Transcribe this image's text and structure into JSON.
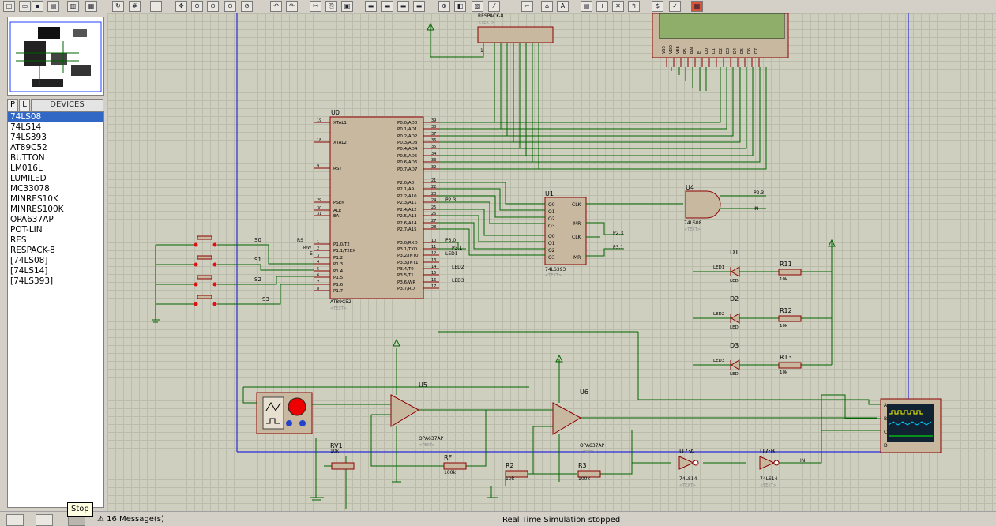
{
  "devices": {
    "header": "DEVICES",
    "tab_p": "P",
    "tab_l": "L",
    "items": [
      "74LS08",
      "74LS14",
      "74LS393",
      "AT89C52",
      "BUTTON",
      "LM016L",
      "LUMILED",
      "MC33078",
      "MINRES10K",
      "MINRES100K",
      "OPA637AP",
      "POT-LIN",
      "RES",
      "RESPACK-8",
      "[74LS08]",
      "[74LS14]",
      "[74LS393]"
    ],
    "selected": 0
  },
  "status": {
    "tooltip": "Stop",
    "messages": "16 Message(s)",
    "sim": "Real Time Simulation stopped"
  },
  "colors": {
    "wire": "#006400",
    "part": "#c8b8a0",
    "part_border": "#8b0000",
    "text": "#000080",
    "accent": "#3168c6"
  },
  "schematic": {
    "u0": {
      "ref": "U0",
      "type": "AT89C52",
      "text": "<TEXT>",
      "left_pins": [
        [
          "19",
          "XTAL1"
        ],
        [
          "18",
          "XTAL2"
        ],
        [
          "9",
          "RST"
        ],
        [
          "29",
          "PSEN"
        ],
        [
          "30",
          "ALE"
        ],
        [
          "31",
          "EA"
        ],
        [
          "1",
          "P1.0/T2"
        ],
        [
          "2",
          "P1.1/T2EX"
        ],
        [
          "3",
          "P1.2"
        ],
        [
          "4",
          "P1.3"
        ],
        [
          "5",
          "P1.4"
        ],
        [
          "6",
          "P1.5"
        ],
        [
          "7",
          "P1.6"
        ],
        [
          "8",
          "P1.7"
        ]
      ],
      "right_pins": [
        [
          "39",
          "P0.0/AD0"
        ],
        [
          "38",
          "P0.1/AD1"
        ],
        [
          "37",
          "P0.2/AD2"
        ],
        [
          "36",
          "P0.3/AD3"
        ],
        [
          "35",
          "P0.4/AD4"
        ],
        [
          "34",
          "P0.5/AD5"
        ],
        [
          "33",
          "P0.6/AD6"
        ],
        [
          "32",
          "P0.7/AD7"
        ],
        [
          "21",
          "P2.0/A8"
        ],
        [
          "22",
          "P2.1/A9"
        ],
        [
          "23",
          "P2.2/A10"
        ],
        [
          "24",
          "P2.3/A11"
        ],
        [
          "25",
          "P2.4/A12"
        ],
        [
          "26",
          "P2.5/A13"
        ],
        [
          "27",
          "P2.6/A14"
        ],
        [
          "28",
          "P2.7/A15"
        ],
        [
          "10",
          "P3.0/RXD"
        ],
        [
          "11",
          "P3.1/TXD"
        ],
        [
          "12",
          "P3.2/INT0"
        ],
        [
          "13",
          "P3.3/INT1"
        ],
        [
          "14",
          "P3.4/T0"
        ],
        [
          "15",
          "P3.5/T1"
        ],
        [
          "16",
          "P3.6/WR"
        ],
        [
          "17",
          "P3.7/RD"
        ]
      ]
    },
    "u1": {
      "ref": "U1",
      "type": "74LS393",
      "text": "<TEXT>",
      "pins": [
        "Q0",
        "Q1",
        "Q2",
        "Q3",
        "CLK",
        "MR",
        "Q0",
        "Q1",
        "Q2",
        "Q3",
        "CLK",
        "MR"
      ]
    },
    "u4": {
      "ref": "U4",
      "type": "74LS08",
      "text": "<TEXT>"
    },
    "u5": {
      "ref": "U5",
      "type": "OPA637AP",
      "text": "<TEXT>"
    },
    "u6": {
      "ref": "U6",
      "type": "OPA637AP",
      "text": "<TEXT>"
    },
    "u7a": {
      "ref": "U7:A",
      "type": "74LS14",
      "text": "<TEXT>"
    },
    "u7b": {
      "ref": "U7:B",
      "type": "74LS14",
      "text": "<TEXT>"
    },
    "lcd_pins": [
      "VSS",
      "VDD",
      "VEE",
      "RS",
      "RW",
      "E",
      "D0",
      "D1",
      "D2",
      "D3",
      "D4",
      "D5",
      "D6",
      "D7"
    ],
    "respack": {
      "ref": "RESPACK-8",
      "text": "<TEXT>"
    },
    "buttons": [
      "S0",
      "S1",
      "S2",
      "S3"
    ],
    "leds": [
      {
        "ref": "D1",
        "type": "LED",
        "net": "LED1",
        "r": "R11",
        "rv": "10k"
      },
      {
        "ref": "D2",
        "type": "LED",
        "net": "LED2",
        "r": "R12",
        "rv": "10k"
      },
      {
        "ref": "D3",
        "type": "LED",
        "net": "LED3",
        "r": "R13",
        "rv": "10k"
      }
    ],
    "rv1": {
      "ref": "RV1",
      "value": "10k"
    },
    "rf": {
      "ref": "RF",
      "value": "100k"
    },
    "r2": {
      "ref": "R2",
      "value": "10k"
    },
    "r3": {
      "ref": "R3",
      "value": "100k"
    },
    "nets": [
      "P2.3",
      "P3.0",
      "P3.1",
      "LED1",
      "LED2",
      "LED3",
      "IN",
      "RS",
      "R/W",
      "E"
    ],
    "scope_channels": [
      "A",
      "B",
      "C",
      "D"
    ]
  }
}
